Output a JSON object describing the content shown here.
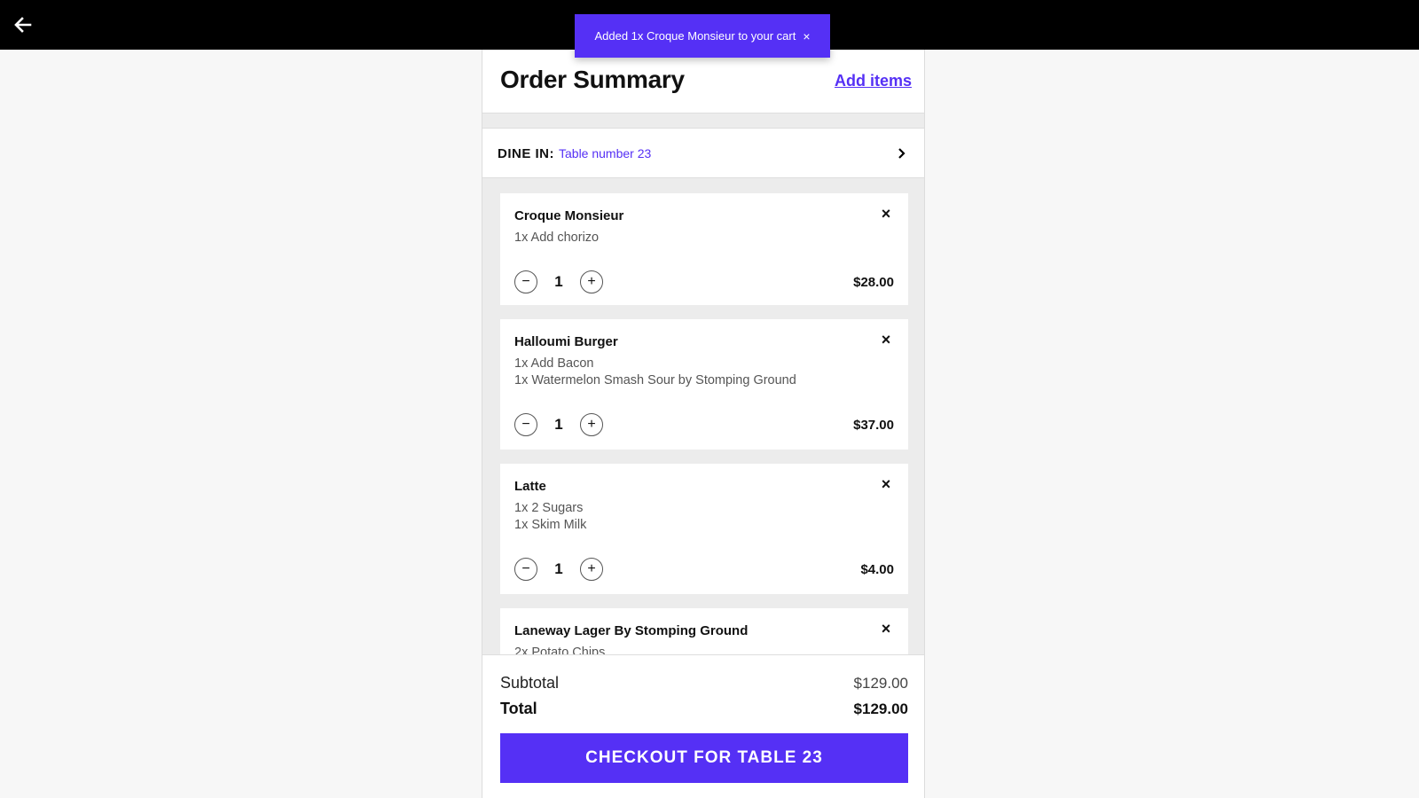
{
  "toast": {
    "message": "Added 1x Croque Monsieur to your cart",
    "close": "×"
  },
  "header": {
    "title": "Order Summary",
    "add_items": "Add items"
  },
  "dine_in": {
    "label": "DINE IN:",
    "value": "Table number 23"
  },
  "items": [
    {
      "name": "Croque Monsieur",
      "modifiers": [
        "1x Add chorizo"
      ],
      "quantity": "1",
      "price": "$28.00"
    },
    {
      "name": "Halloumi Burger",
      "modifiers": [
        "1x Add Bacon",
        "1x Watermelon Smash Sour by Stomping Ground"
      ],
      "quantity": "1",
      "price": "$37.00"
    },
    {
      "name": "Latte",
      "modifiers": [
        "1x 2 Sugars",
        "1x Skim Milk"
      ],
      "quantity": "1",
      "price": "$4.00"
    },
    {
      "name": "Laneway Lager By Stomping Ground",
      "modifiers": [
        "2x Potato Chips"
      ],
      "quantity": "",
      "price": ""
    }
  ],
  "controls": {
    "minus": "−",
    "plus": "+",
    "remove": "×"
  },
  "summary": {
    "subtotal_label": "Subtotal",
    "subtotal_value": "$129.00",
    "total_label": "Total",
    "total_value": "$129.00"
  },
  "checkout": {
    "label": "CHECKOUT FOR TABLE 23"
  },
  "colors": {
    "accent": "#5530f5",
    "topbar": "#000000",
    "panel_bg": "#ececec"
  },
  "icons": {
    "back": "arrow-left-icon",
    "dine_chevron": "chevron-right-icon"
  }
}
